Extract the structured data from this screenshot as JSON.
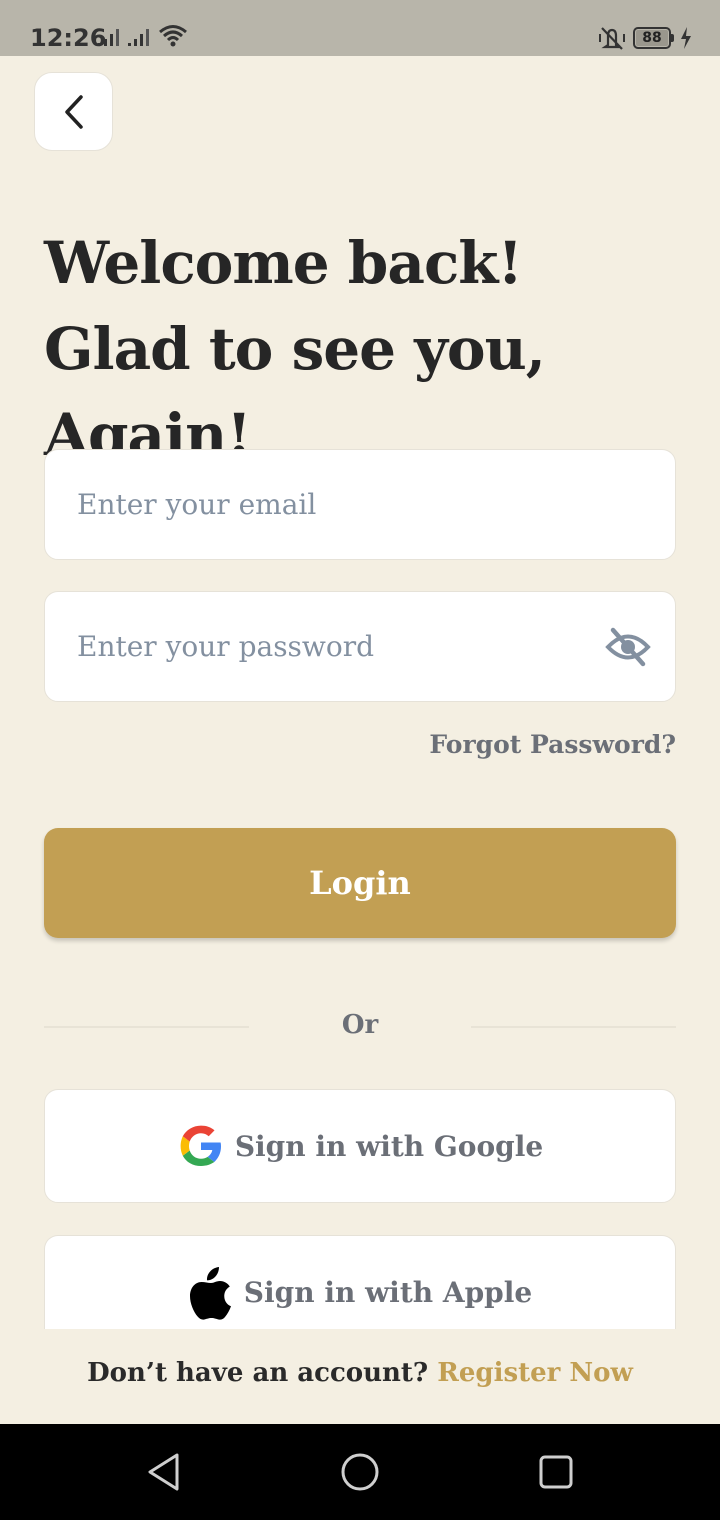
{
  "status_bar": {
    "time": "12:26",
    "battery_level": "88"
  },
  "header": {
    "back_icon": "chevron-left-icon"
  },
  "page": {
    "title": "Welcome back! Glad to see you, Again!"
  },
  "form": {
    "email_placeholder": "Enter your email",
    "password_placeholder": "Enter your password",
    "password_toggle_icon": "eye-slash-icon",
    "forgot_password": "Forgot Password?",
    "login_label": "Login"
  },
  "divider": {
    "label": "Or"
  },
  "social": {
    "google_label": "Sign in with Google",
    "apple_label": "Sign in with Apple"
  },
  "footer": {
    "register_prompt": "Don’t have an account?",
    "register_link": "Register Now"
  },
  "colors": {
    "background": "#f4efe2",
    "accent": "#c29f53",
    "placeholder": "#8390a0",
    "muted_text": "#6b6f77"
  }
}
